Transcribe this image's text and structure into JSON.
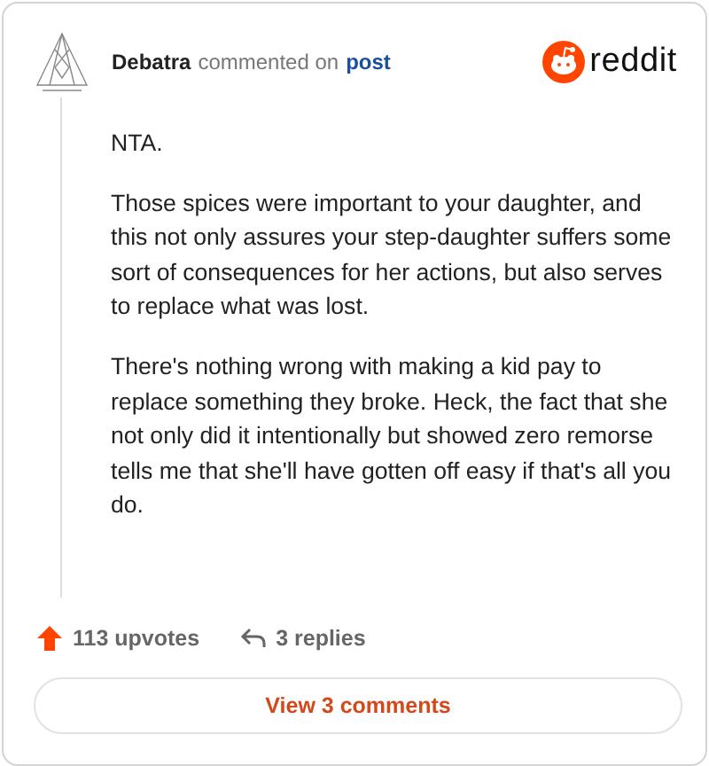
{
  "header": {
    "author": "Debatra",
    "action": "commented on",
    "link": "post",
    "brand": "reddit"
  },
  "body": [
    "NTA.",
    "Those spices were important to your daughter, and this not only assures your step-daughter suffers some sort of consequences for her actions, but also serves to replace what was lost.",
    "There's nothing wrong with making a kid pay to replace something they broke. Heck, the fact that she not only did it intentionally but showed zero remorse tells me that she'll have gotten off easy if that's all you do."
  ],
  "footer": {
    "upvotes": "113 upvotes",
    "replies": "3 replies",
    "button": "View 3 comments"
  }
}
